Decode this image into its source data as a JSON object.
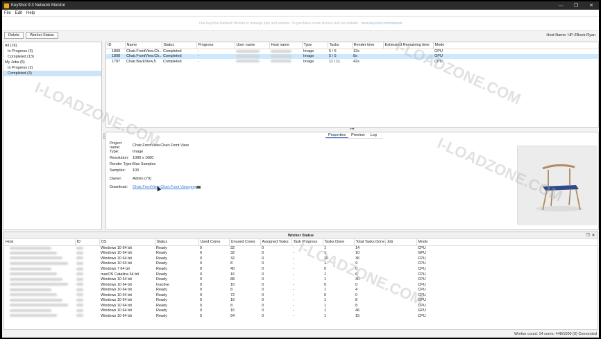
{
  "window": {
    "title": "KeyShot 9.3 Network Monitor",
    "controls": [
      "—",
      "❐",
      "✕"
    ]
  },
  "menu": [
    "File",
    "Edit",
    "Help"
  ],
  "notice": {
    "text": "Use KeyShot Network Monitor to manage jobs and workers. To purchase a new license visit our website.",
    "link": "www.keyshot.com/network"
  },
  "toolbar": {
    "delete_label": "Delete",
    "worker_status_label": "Worker Status",
    "host_name": "Host Name: HP-ZBook-Ryan"
  },
  "tree": [
    {
      "label": "All (16)",
      "level": 0,
      "selected": false
    },
    {
      "label": "In Progress (3)",
      "level": 1,
      "selected": false
    },
    {
      "label": "Completed (13)",
      "level": 1,
      "selected": false
    },
    {
      "label": "My Jobs (5)",
      "level": 0,
      "selected": false
    },
    {
      "label": "In Progress (2)",
      "level": 1,
      "selected": false
    },
    {
      "label": "Completed (3)",
      "level": 1,
      "selected": true
    }
  ],
  "jobs": {
    "columns": [
      "ID",
      "Name",
      "Status",
      "Progress",
      "User name",
      "Host name",
      "Type",
      "Tasks",
      "Render time",
      "Estimated Remaining time",
      "Mode"
    ],
    "rows": [
      {
        "id": "1809",
        "name": "Chair.FrontView.Ch...",
        "status": "Completed",
        "progress": "-",
        "type": "Image",
        "tasks": "5 / 5",
        "render_time": "12s",
        "remaining": "",
        "mode": "GPU",
        "selected": false
      },
      {
        "id": "1808",
        "name": "Chair.FrontView.Ch...",
        "status": "Completed",
        "progress": "-",
        "type": "Image",
        "tasks": "5 / 5",
        "render_time": "8s",
        "remaining": "",
        "mode": "GPU",
        "selected": true
      },
      {
        "id": "1787",
        "name": "Chair.BackView.5",
        "status": "Completed",
        "progress": "-",
        "type": "Image",
        "tasks": "11 / 11",
        "render_time": "42s",
        "remaining": "",
        "mode": "CPU",
        "selected": false
      }
    ]
  },
  "detail_tabs": [
    "Properties",
    "Preview",
    "Log"
  ],
  "properties": {
    "project_name_label": "Project name:",
    "project_name": "Chair.FrontView.Chair.Front View",
    "type_label": "Type:",
    "type": "Image",
    "resolution_label": "Resolution:",
    "resolution": "1080 x 1080",
    "render_type_label": "Render Type:",
    "render_type": "Max Samples",
    "samples_label": "Samples:",
    "samples": "100",
    "owner_label": "Owner:",
    "owner": "Admin (70)",
    "download_label": "Download:",
    "download": "Chair.FrontView.Chair.Front View.png"
  },
  "worker_panel": {
    "title": "Worker Status",
    "columns": [
      "Host",
      "ID",
      "OS",
      "Status",
      "Used Cores",
      "Unused Cores",
      "Assigned Tasks",
      "Task Progress",
      "Tasks Done",
      "Total Tasks Done",
      "Job",
      "Mode"
    ],
    "rows": [
      {
        "os": "Windows 10 64 bit",
        "status": "Ready",
        "used": "0",
        "unused": "32",
        "assigned": "0",
        "progress": "-",
        "done": "1",
        "total": "14",
        "job": "",
        "mode": "CPU"
      },
      {
        "os": "Windows 10 64 bit",
        "status": "Ready",
        "used": "0",
        "unused": "32",
        "assigned": "0",
        "progress": "-",
        "done": "1",
        "total": "10",
        "job": "",
        "mode": "GPU"
      },
      {
        "os": "Windows 10 64 bit",
        "status": "Ready",
        "used": "0",
        "unused": "32",
        "assigned": "0",
        "progress": "-",
        "done": "10",
        "total": "36",
        "job": "",
        "mode": "CPU"
      },
      {
        "os": "Windows 10 64 bit",
        "status": "Ready",
        "used": "0",
        "unused": "8",
        "assigned": "0",
        "progress": "-",
        "done": "1",
        "total": "9",
        "job": "",
        "mode": "CPU"
      },
      {
        "os": "Windows 7 64 bit",
        "status": "Ready",
        "used": "0",
        "unused": "40",
        "assigned": "0",
        "progress": "-",
        "done": "0",
        "total": "0",
        "job": "",
        "mode": "CPU"
      },
      {
        "os": "macOS Catalina 64 bit",
        "status": "Ready",
        "used": "0",
        "unused": "16",
        "assigned": "0",
        "progress": "-",
        "done": "1",
        "total": "6",
        "job": "",
        "mode": "CPU"
      },
      {
        "os": "Windows 10 64 bit",
        "status": "Ready",
        "used": "0",
        "unused": "88",
        "assigned": "0",
        "progress": "-",
        "done": "1",
        "total": "30",
        "job": "",
        "mode": "CPU"
      },
      {
        "os": "Windows 10 64 bit",
        "status": "Inactive",
        "used": "0",
        "unused": "16",
        "assigned": "0",
        "progress": "-",
        "done": "0",
        "total": "0",
        "job": "",
        "mode": "CPU"
      },
      {
        "os": "Windows 10 64 bit",
        "status": "Ready",
        "used": "0",
        "unused": "8",
        "assigned": "0",
        "progress": "-",
        "done": "1",
        "total": "4",
        "job": "",
        "mode": "CPU"
      },
      {
        "os": "Windows 10 64 bit",
        "status": "Ready",
        "used": "0",
        "unused": "72",
        "assigned": "0",
        "progress": "-",
        "done": "0",
        "total": "0",
        "job": "",
        "mode": "CPU"
      },
      {
        "os": "Windows 10 64 bit",
        "status": "Ready",
        "used": "0",
        "unused": "16",
        "assigned": "0",
        "progress": "-",
        "done": "1",
        "total": "8",
        "job": "",
        "mode": "GPU"
      },
      {
        "os": "Windows 10 64 bit",
        "status": "Ready",
        "used": "0",
        "unused": "8",
        "assigned": "0",
        "progress": "-",
        "done": "1",
        "total": "8",
        "job": "",
        "mode": "CPU"
      },
      {
        "os": "Windows 10 64 bit",
        "status": "Ready",
        "used": "0",
        "unused": "16",
        "assigned": "0",
        "progress": "-",
        "done": "1",
        "total": "46",
        "job": "",
        "mode": "GPU"
      },
      {
        "os": "Windows 10 64 bit",
        "status": "Ready",
        "used": "0",
        "unused": "64",
        "assigned": "0",
        "progress": "-",
        "done": "1",
        "total": "15",
        "job": "",
        "mode": "CPU"
      }
    ]
  },
  "status_bar": "Worker count: 14 cores: 448/1000 (0) Connected",
  "watermarks": [
    "I-LOADZONE.COM",
    "I-LOADZONE.COM",
    "I-LOADZONE.COM",
    "I-LOADZONE.COM"
  ],
  "colors": {
    "selection": "#cde8ff",
    "link": "#3a7bd5",
    "titlebar": "#2b2b2b"
  }
}
